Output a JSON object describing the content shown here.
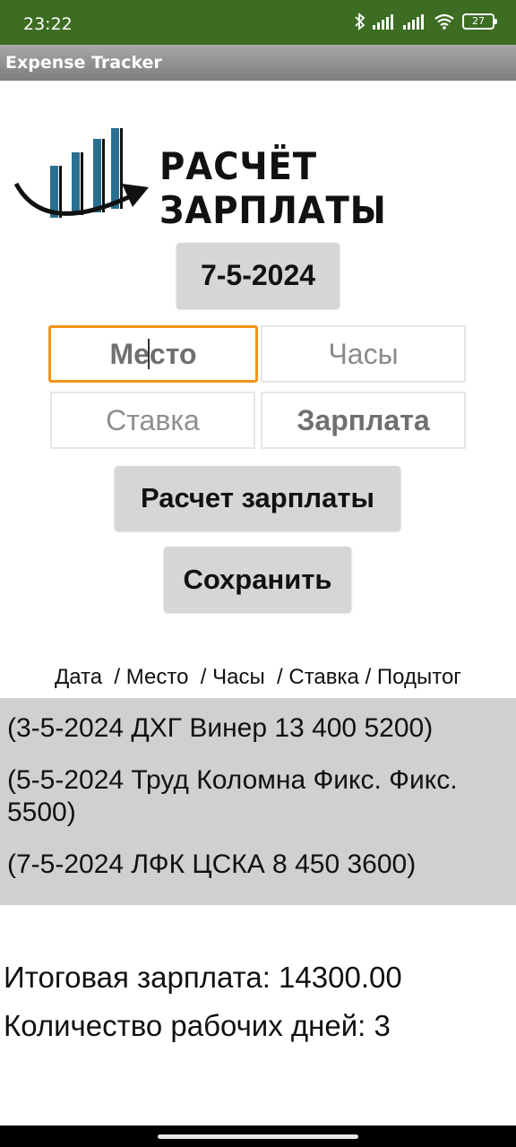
{
  "status_bar": {
    "time": "23:22",
    "battery": "27",
    "icons": [
      "bluetooth-icon",
      "signal-icon",
      "signal-icon",
      "wifi-icon",
      "battery-icon"
    ]
  },
  "app_bar": {
    "title": "Expense Tracker"
  },
  "logo": {
    "text": "РАСЧЁТ ЗАРПЛАТЫ"
  },
  "date_button": {
    "label": "7-5-2024"
  },
  "inputs": {
    "place": {
      "placeholder": "Место"
    },
    "hours": {
      "placeholder": "Часы"
    },
    "rate": {
      "placeholder": "Ставка"
    },
    "salary": {
      "value": "Зарплата"
    }
  },
  "calculate_button": {
    "label": "Расчет зарплаты"
  },
  "save_button": {
    "label": "Сохранить"
  },
  "list_header": "Дата  / Место  / Часы  / Ставка / Подытог",
  "records": [
    "(3-5-2024 ДХГ Винер 13 400 5200)",
    "(5-5-2024 Труд Коломна Фикс. Фикс. 5500)",
    "(7-5-2024 ЛФК ЦСКА 8 450 3600)"
  ],
  "summary": {
    "total": "Итоговая зарплата: 14300.00",
    "days": "Количество рабочих дней: 3"
  },
  "colors": {
    "status_bar": "#3d6d23",
    "focus_border": "#f29418",
    "list_background": "#d0d0d0",
    "button_background": "#d6d6d6"
  }
}
